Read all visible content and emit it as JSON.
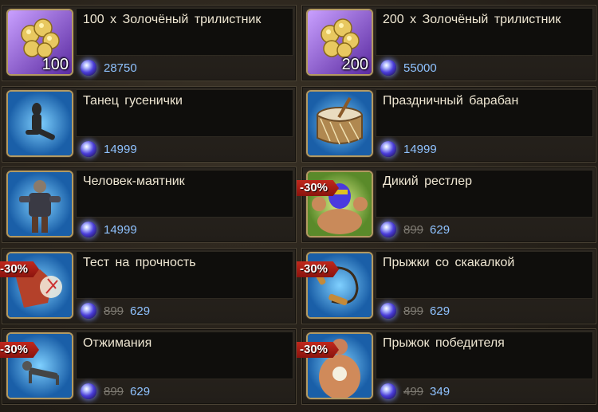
{
  "items": [
    {
      "title": "100 x Золочёный трилистник",
      "price": "28750",
      "old_price": null,
      "discount": null,
      "qty": "100",
      "icon": "golden-clover-icon"
    },
    {
      "title": "200 x Золочёный трилистник",
      "price": "55000",
      "old_price": null,
      "discount": null,
      "qty": "200",
      "icon": "golden-clover-icon"
    },
    {
      "title": "Танец гусенички",
      "price": "14999",
      "old_price": null,
      "discount": null,
      "qty": null,
      "icon": "caterpillar-dance-icon"
    },
    {
      "title": "Праздничный барабан",
      "price": "14999",
      "old_price": null,
      "discount": null,
      "qty": null,
      "icon": "drum-icon"
    },
    {
      "title": "Человек-маятник",
      "price": "14999",
      "old_price": null,
      "discount": null,
      "qty": null,
      "icon": "pendulum-man-icon"
    },
    {
      "title": "Дикий рестлер",
      "price": "629",
      "old_price": "899",
      "discount": "-30%",
      "qty": null,
      "icon": "wrestler-icon"
    },
    {
      "title": "Тест на прочность",
      "price": "629",
      "old_price": "899",
      "discount": "-30%",
      "qty": null,
      "icon": "strength-test-icon"
    },
    {
      "title": "Прыжки со скакалкой",
      "price": "629",
      "old_price": "899",
      "discount": "-30%",
      "qty": null,
      "icon": "jump-rope-icon"
    },
    {
      "title": "Отжимания",
      "price": "629",
      "old_price": "899",
      "discount": "-30%",
      "qty": null,
      "icon": "pushups-icon"
    },
    {
      "title": "Прыжок победителя",
      "price": "349",
      "old_price": "499",
      "discount": "-30%",
      "qty": null,
      "icon": "winner-jump-icon"
    }
  ],
  "currency_icon": "gem-icon",
  "colors": {
    "price": "#8fc2ff",
    "old_price": "#7e7a72",
    "discount": "#c0281c",
    "frame": "#b39a62"
  }
}
